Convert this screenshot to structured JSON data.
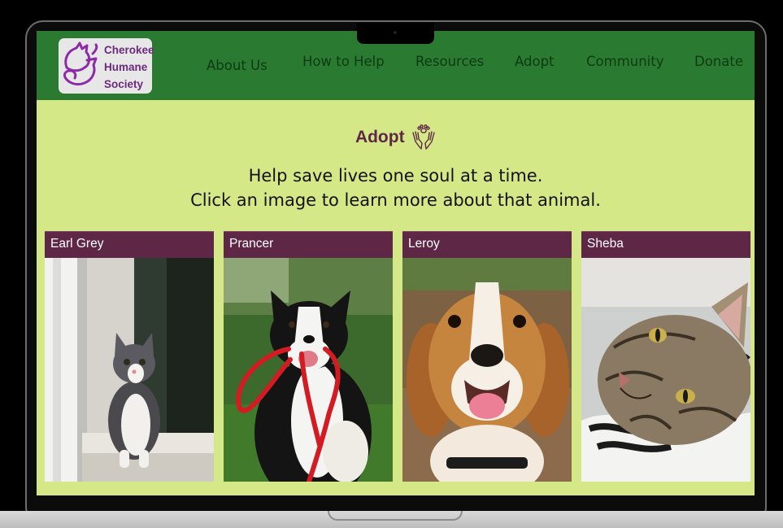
{
  "org": {
    "name_lines": [
      "Cherokee",
      "Humane",
      "Society"
    ]
  },
  "nav": {
    "items": [
      "About Us",
      "How to Help",
      "Resources",
      "Adopt",
      "Community",
      "Donate"
    ]
  },
  "page": {
    "title": "Adopt",
    "tagline_1": "Help save lives one soul at a time.",
    "tagline_2": "Click an image to learn more about that animal."
  },
  "animals": [
    {
      "name": "Earl Grey",
      "photo": "gray-white-kitten-photo"
    },
    {
      "name": "Prancer",
      "photo": "border-collie-with-red-leash-photo"
    },
    {
      "name": "Leroy",
      "photo": "beagle-photo"
    },
    {
      "name": "Sheba",
      "photo": "tabby-cat-photo"
    }
  ],
  "colors": {
    "header_green": "#2b7a32",
    "page_background": "#d5e888",
    "accent_purple": "#5e2746",
    "logo_purple": "#8d2aa8"
  }
}
